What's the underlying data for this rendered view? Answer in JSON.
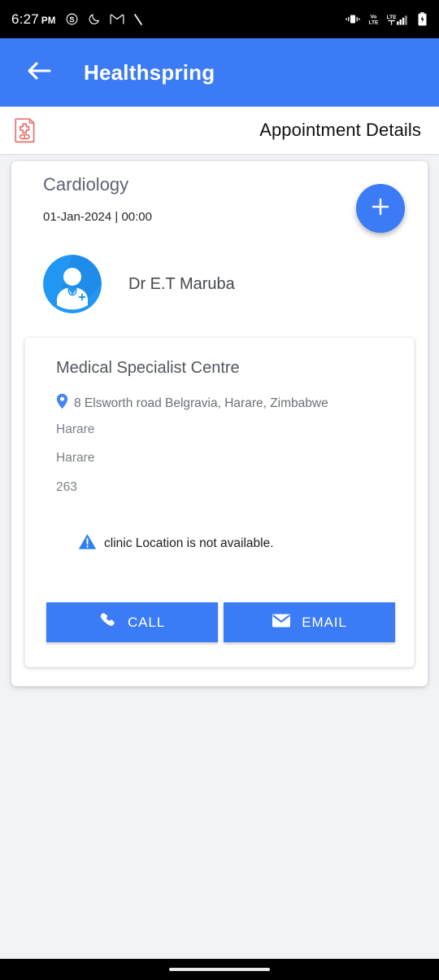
{
  "status_bar": {
    "time": "6:27",
    "ampm": "PM",
    "left_icons": [
      "skype-icon",
      "do-not-disturb-moon-icon",
      "gmail-icon",
      "backslash-icon"
    ],
    "right_icons": [
      "vibrate-icon",
      "volte-icon",
      "lte-signal-icon",
      "battery-charging-icon"
    ],
    "volte_label": "Vo",
    "volte_label2": "LTE",
    "lte_label": "LTE"
  },
  "app_bar": {
    "title": "Healthspring",
    "back_icon": "arrow-left-icon",
    "background": "#3b7bf6"
  },
  "sub_header": {
    "icon": "medical-record-icon",
    "title": "Appointment Details"
  },
  "appointment": {
    "specialty": "Cardiology",
    "datetime": "01-Jan-2024 | 00:00",
    "add_button_label": "+",
    "doctor": {
      "avatar_icon": "doctor-avatar-icon",
      "name": "Dr E.T Maruba"
    }
  },
  "clinic": {
    "name": "Medical Specialist Centre",
    "address_icon": "location-pin-icon",
    "address": "8 Elsworth road Belgravia, Harare, Zimbabwe",
    "city": "Harare",
    "region": "Harare",
    "country_code": "263",
    "warning_icon": "warning-triangle-icon",
    "warning_text": "clinic Location is not available.",
    "buttons": [
      {
        "label": "CALL",
        "icon": "phone-icon"
      },
      {
        "label": "EMAIL",
        "icon": "envelope-icon"
      }
    ]
  },
  "nav_bar": {
    "gesture_pill": "home-gesture-pill"
  },
  "colors": {
    "primary_blue": "#3b7bf6",
    "avatar_blue": "#2196f3",
    "pin_blue": "#4285f4",
    "record_icon_red": "#e5716e",
    "page_background": "#f2f3f7"
  }
}
